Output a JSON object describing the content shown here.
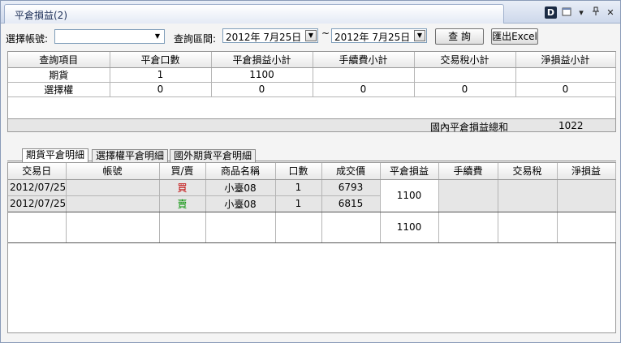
{
  "window": {
    "title": "平倉損益(2)",
    "icons": [
      "d-logo-icon",
      "window-icon",
      "dropdown-icon",
      "pin-icon",
      "close-icon"
    ],
    "controls": {
      "dropdown": "▾",
      "pin": "ᵖ",
      "close": "✕"
    }
  },
  "filter": {
    "account_label": "選擇帳號:",
    "account_value": "",
    "range_label": "查詢區間:",
    "date_from": "2012年  7月25日",
    "tilde": "~",
    "date_to": "2012年  7月25日",
    "query_button": "查 詢",
    "export_button": "匯出Excel"
  },
  "summary": {
    "headers": [
      "查詢項目",
      "平倉口數",
      "平倉損益小計",
      "手續費小計",
      "交易稅小計",
      "淨損益小計"
    ],
    "rows": [
      [
        "期貨",
        "1",
        "1100",
        "",
        "",
        ""
      ],
      [
        "選擇權",
        "0",
        "0",
        "0",
        "0",
        "0"
      ]
    ],
    "total_label": "國內平倉損益總和",
    "total_value": "1022"
  },
  "tabs": [
    "期貨平倉明細",
    "選擇權平倉明細",
    "國外期貨平倉明細"
  ],
  "detail": {
    "headers": [
      "交易日",
      "帳號",
      "買/賣",
      "商品名稱",
      "口數",
      "成交價",
      "平倉損益",
      "手續費",
      "交易稅",
      "淨損益"
    ],
    "rows": [
      {
        "date": "2012/07/25",
        "account": "",
        "side": "買",
        "product": "小臺08",
        "qty": "1",
        "price": "6793"
      },
      {
        "date": "2012/07/25",
        "account": "",
        "side": "賣",
        "product": "小臺08",
        "qty": "1",
        "price": "6815"
      }
    ],
    "pair_pnl": "1100",
    "subtotal_pnl": "1100"
  },
  "colors": {
    "buy": "#c00000",
    "sell": "#009000",
    "accent": "#1d2f57"
  }
}
